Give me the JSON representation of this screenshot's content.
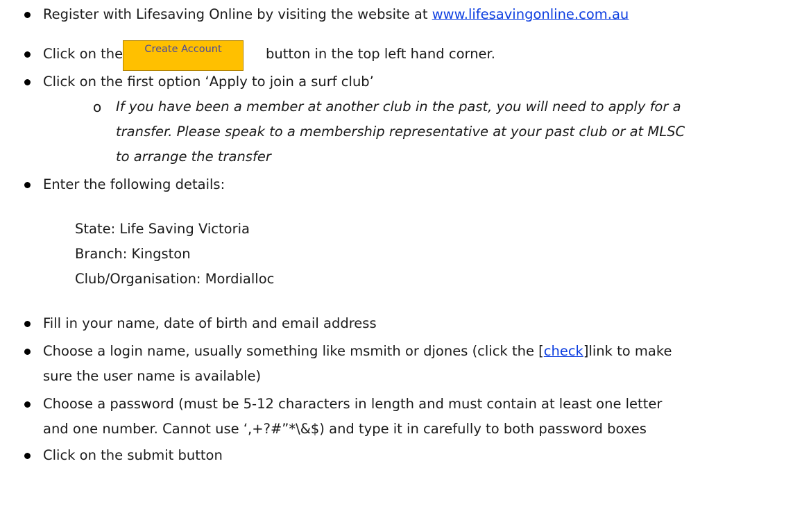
{
  "steps": {
    "register_prefix": "Register with Lifesaving Online by visiting the website at ",
    "register_link": "www.lifesavingonline.com.au",
    "click_prefix": "Click on the",
    "click_suffix": "button in the top left hand corner.",
    "create_account_label": "Create Account",
    "first_option": "Click on the first option ‘Apply to join a surf club’",
    "note_line1": "If you have been a member at another club in the past, you will need to apply for a",
    "note_line2": "transfer. Please speak to a membership representative at your past club or at MLSC",
    "note_line3": "to arrange the transfer",
    "enter_details": "Enter the following details:",
    "detail_state": "State: Life Saving Victoria",
    "detail_branch": "Branch: Kingston",
    "detail_club": "Club/Organisation: Mordialloc",
    "fill_in": "Fill in your name, date of birth and email address",
    "login_prefix": "Choose a login name, usually something like msmith or djones (click the [",
    "login_link": "check",
    "login_suffix": "]link to make",
    "login_line2": "sure the user name is available)",
    "password_line1": "Choose a password (must be 5-12 characters in length and must contain at least one letter",
    "password_line2": "and one number. Cannot use ‘,+?#”*\\&$) and type it in carefully to both password boxes",
    "submit": "Click on the submit button"
  },
  "colors": {
    "button": "#ffc000",
    "link": "#0b3de0"
  }
}
